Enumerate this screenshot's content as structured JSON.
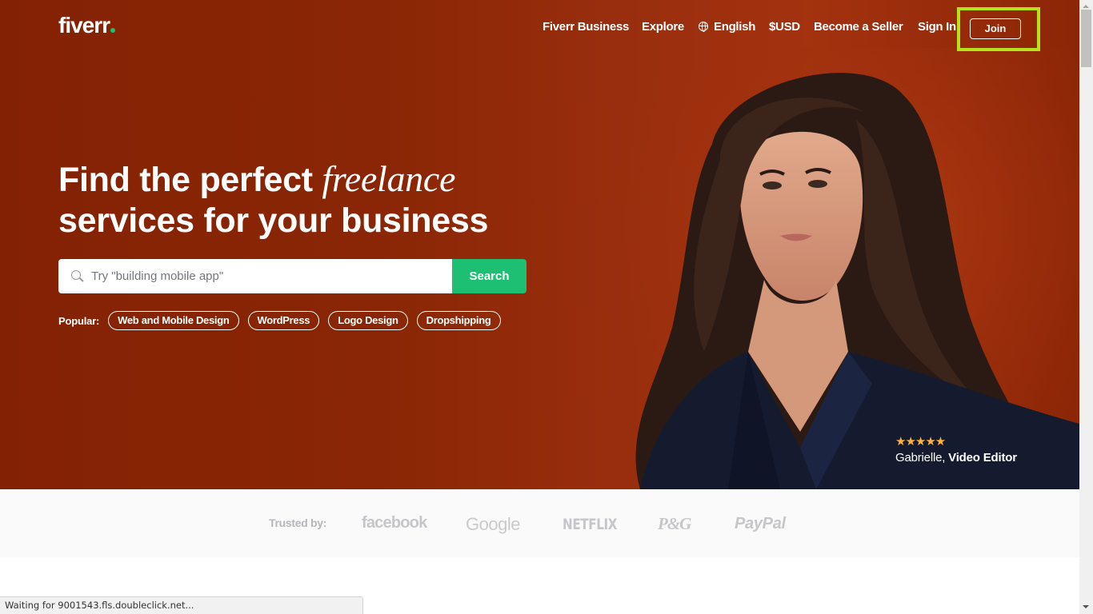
{
  "header": {
    "logo": "fiverr",
    "nav": [
      {
        "label": "Fiverr Business"
      },
      {
        "label": "Explore"
      },
      {
        "label": "English",
        "icon": "globe-icon"
      },
      {
        "label": "$USD"
      },
      {
        "label": "Become a Seller"
      },
      {
        "label": "Sign In"
      }
    ],
    "join_label": "Join"
  },
  "hero": {
    "headline_part1": "Find the perfect ",
    "headline_em": "freelance",
    "headline_part2": "services for your business",
    "search": {
      "placeholder": "Try \"building mobile app\"",
      "value": "",
      "button_label": "Search"
    },
    "popular": {
      "label": "Popular:",
      "items": [
        "Web and Mobile Design",
        "WordPress",
        "Logo Design",
        "Dropshipping"
      ]
    },
    "caption": {
      "rating": 5,
      "stars": "★★★★★",
      "name": "Gabrielle,",
      "role": "Video Editor"
    }
  },
  "trusted": {
    "label": "Trusted by:",
    "brands": [
      "facebook",
      "Google",
      "NETFLIX",
      "P&G",
      "PayPal"
    ]
  },
  "status_bar": {
    "text": "Waiting for 9001543.fls.doubleclick.net..."
  },
  "colors": {
    "hero_bg": "#8a2605",
    "brand_green": "#1dbf73",
    "highlight": "#b5e31b",
    "star": "#ffb33e"
  }
}
